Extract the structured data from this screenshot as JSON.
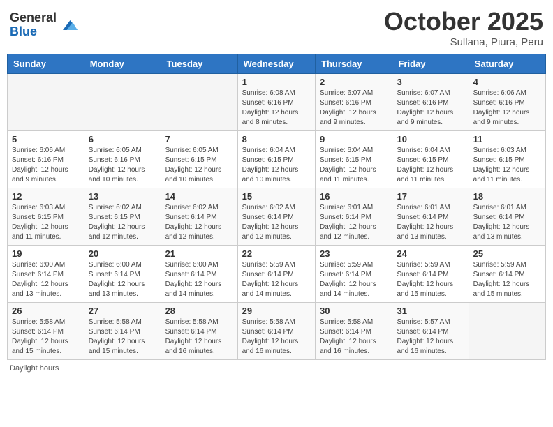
{
  "header": {
    "logo_general": "General",
    "logo_blue": "Blue",
    "month": "October 2025",
    "location": "Sullana, Piura, Peru"
  },
  "weekdays": [
    "Sunday",
    "Monday",
    "Tuesday",
    "Wednesday",
    "Thursday",
    "Friday",
    "Saturday"
  ],
  "weeks": [
    [
      {
        "day": "",
        "info": ""
      },
      {
        "day": "",
        "info": ""
      },
      {
        "day": "",
        "info": ""
      },
      {
        "day": "1",
        "info": "Sunrise: 6:08 AM\nSunset: 6:16 PM\nDaylight: 12 hours\nand 8 minutes."
      },
      {
        "day": "2",
        "info": "Sunrise: 6:07 AM\nSunset: 6:16 PM\nDaylight: 12 hours\nand 9 minutes."
      },
      {
        "day": "3",
        "info": "Sunrise: 6:07 AM\nSunset: 6:16 PM\nDaylight: 12 hours\nand 9 minutes."
      },
      {
        "day": "4",
        "info": "Sunrise: 6:06 AM\nSunset: 6:16 PM\nDaylight: 12 hours\nand 9 minutes."
      }
    ],
    [
      {
        "day": "5",
        "info": "Sunrise: 6:06 AM\nSunset: 6:16 PM\nDaylight: 12 hours\nand 9 minutes."
      },
      {
        "day": "6",
        "info": "Sunrise: 6:05 AM\nSunset: 6:16 PM\nDaylight: 12 hours\nand 10 minutes."
      },
      {
        "day": "7",
        "info": "Sunrise: 6:05 AM\nSunset: 6:15 PM\nDaylight: 12 hours\nand 10 minutes."
      },
      {
        "day": "8",
        "info": "Sunrise: 6:04 AM\nSunset: 6:15 PM\nDaylight: 12 hours\nand 10 minutes."
      },
      {
        "day": "9",
        "info": "Sunrise: 6:04 AM\nSunset: 6:15 PM\nDaylight: 12 hours\nand 11 minutes."
      },
      {
        "day": "10",
        "info": "Sunrise: 6:04 AM\nSunset: 6:15 PM\nDaylight: 12 hours\nand 11 minutes."
      },
      {
        "day": "11",
        "info": "Sunrise: 6:03 AM\nSunset: 6:15 PM\nDaylight: 12 hours\nand 11 minutes."
      }
    ],
    [
      {
        "day": "12",
        "info": "Sunrise: 6:03 AM\nSunset: 6:15 PM\nDaylight: 12 hours\nand 11 minutes."
      },
      {
        "day": "13",
        "info": "Sunrise: 6:02 AM\nSunset: 6:15 PM\nDaylight: 12 hours\nand 12 minutes."
      },
      {
        "day": "14",
        "info": "Sunrise: 6:02 AM\nSunset: 6:14 PM\nDaylight: 12 hours\nand 12 minutes."
      },
      {
        "day": "15",
        "info": "Sunrise: 6:02 AM\nSunset: 6:14 PM\nDaylight: 12 hours\nand 12 minutes."
      },
      {
        "day": "16",
        "info": "Sunrise: 6:01 AM\nSunset: 6:14 PM\nDaylight: 12 hours\nand 12 minutes."
      },
      {
        "day": "17",
        "info": "Sunrise: 6:01 AM\nSunset: 6:14 PM\nDaylight: 12 hours\nand 13 minutes."
      },
      {
        "day": "18",
        "info": "Sunrise: 6:01 AM\nSunset: 6:14 PM\nDaylight: 12 hours\nand 13 minutes."
      }
    ],
    [
      {
        "day": "19",
        "info": "Sunrise: 6:00 AM\nSunset: 6:14 PM\nDaylight: 12 hours\nand 13 minutes."
      },
      {
        "day": "20",
        "info": "Sunrise: 6:00 AM\nSunset: 6:14 PM\nDaylight: 12 hours\nand 13 minutes."
      },
      {
        "day": "21",
        "info": "Sunrise: 6:00 AM\nSunset: 6:14 PM\nDaylight: 12 hours\nand 14 minutes."
      },
      {
        "day": "22",
        "info": "Sunrise: 5:59 AM\nSunset: 6:14 PM\nDaylight: 12 hours\nand 14 minutes."
      },
      {
        "day": "23",
        "info": "Sunrise: 5:59 AM\nSunset: 6:14 PM\nDaylight: 12 hours\nand 14 minutes."
      },
      {
        "day": "24",
        "info": "Sunrise: 5:59 AM\nSunset: 6:14 PM\nDaylight: 12 hours\nand 15 minutes."
      },
      {
        "day": "25",
        "info": "Sunrise: 5:59 AM\nSunset: 6:14 PM\nDaylight: 12 hours\nand 15 minutes."
      }
    ],
    [
      {
        "day": "26",
        "info": "Sunrise: 5:58 AM\nSunset: 6:14 PM\nDaylight: 12 hours\nand 15 minutes."
      },
      {
        "day": "27",
        "info": "Sunrise: 5:58 AM\nSunset: 6:14 PM\nDaylight: 12 hours\nand 15 minutes."
      },
      {
        "day": "28",
        "info": "Sunrise: 5:58 AM\nSunset: 6:14 PM\nDaylight: 12 hours\nand 16 minutes."
      },
      {
        "day": "29",
        "info": "Sunrise: 5:58 AM\nSunset: 6:14 PM\nDaylight: 12 hours\nand 16 minutes."
      },
      {
        "day": "30",
        "info": "Sunrise: 5:58 AM\nSunset: 6:14 PM\nDaylight: 12 hours\nand 16 minutes."
      },
      {
        "day": "31",
        "info": "Sunrise: 5:57 AM\nSunset: 6:14 PM\nDaylight: 12 hours\nand 16 minutes."
      },
      {
        "day": "",
        "info": ""
      }
    ]
  ],
  "footer": "Daylight hours"
}
